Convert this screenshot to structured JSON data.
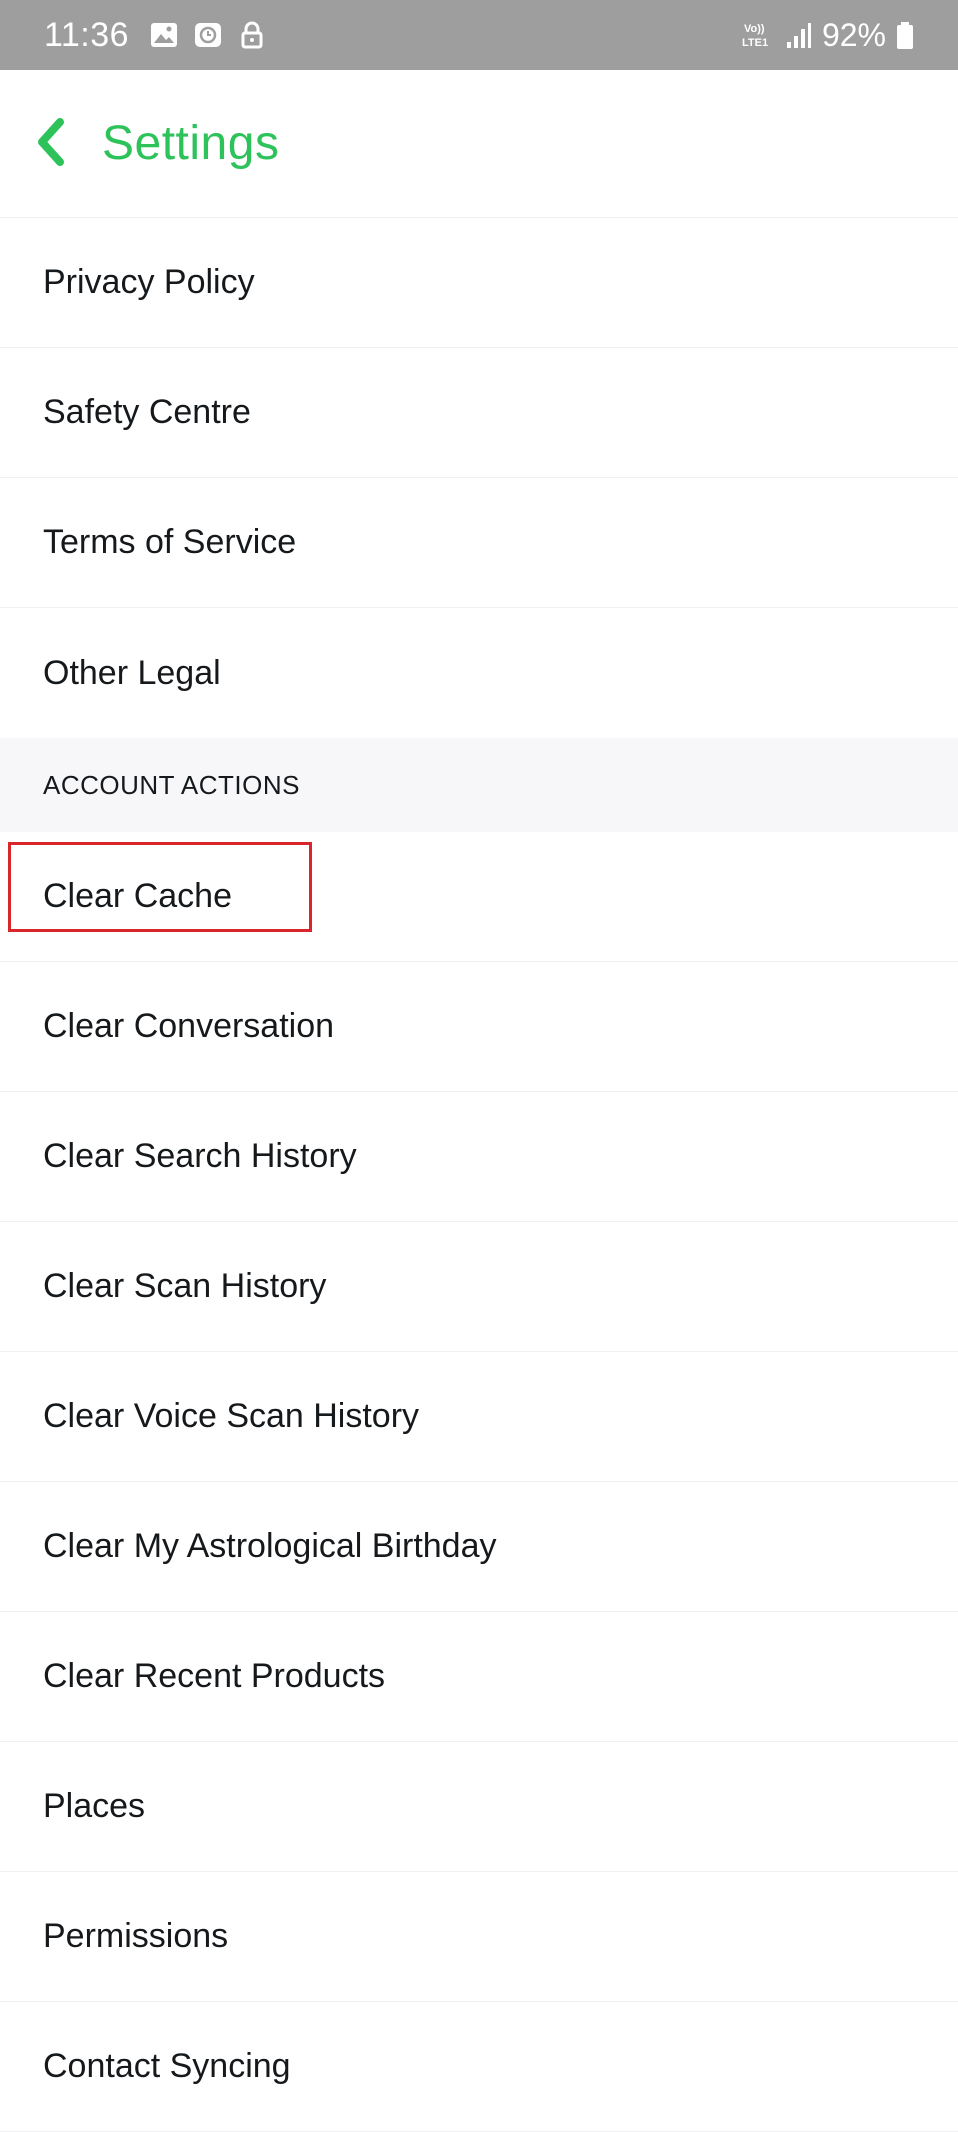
{
  "status_bar": {
    "time": "11:36",
    "network_label": "VoLTE1",
    "battery": "92%",
    "icons": [
      "gallery-icon",
      "alarm-icon",
      "lock-icon",
      "volte-icon",
      "signal-icon",
      "battery-icon"
    ]
  },
  "header": {
    "title": "Settings",
    "back_icon": "chevron-left-icon",
    "accent_color": "#2ec25a"
  },
  "legal_items": [
    {
      "label": "Privacy Policy"
    },
    {
      "label": "Safety Centre"
    },
    {
      "label": "Terms of Service"
    },
    {
      "label": "Other Legal"
    }
  ],
  "account_actions": {
    "section_title": "ACCOUNT ACTIONS",
    "items": [
      {
        "label": "Clear Cache",
        "highlighted": true
      },
      {
        "label": "Clear Conversation"
      },
      {
        "label": "Clear Search History"
      },
      {
        "label": "Clear Scan History"
      },
      {
        "label": "Clear Voice Scan History"
      },
      {
        "label": "Clear My Astrological Birthday"
      },
      {
        "label": "Clear Recent Products"
      },
      {
        "label": "Places"
      },
      {
        "label": "Permissions"
      },
      {
        "label": "Contact Syncing"
      }
    ]
  },
  "highlight_color": "#d9262c"
}
